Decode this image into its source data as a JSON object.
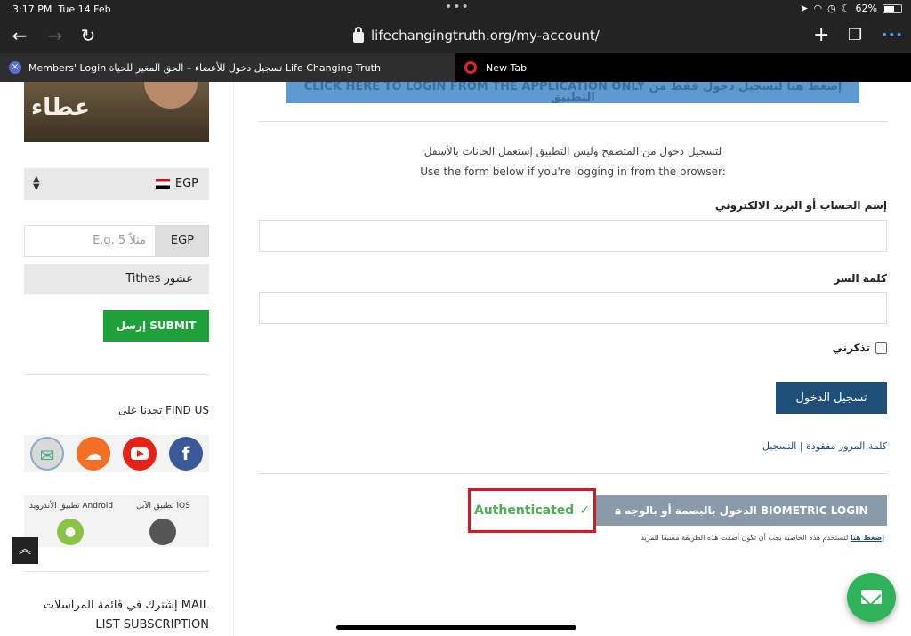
{
  "status_bar": {
    "time": "3:17 PM",
    "date": "Tue 14 Feb",
    "battery_percent": "62%",
    "battery_level": 0.62,
    "icons": [
      "location-icon",
      "wifi-icon",
      "alarm-icon",
      "lock-rotation-icon",
      "moon-icon",
      "battery-icon"
    ]
  },
  "browser": {
    "url": "lifechangingtruth.org/my-account/",
    "tabs": [
      {
        "title": "Members' Login تسجيل دخول للأعضاء – الحق المغير للحياة Life Changing Truth"
      },
      {
        "title": "New Tab"
      }
    ]
  },
  "sidebar": {
    "banner_text": "عطاء",
    "currency_select": "EGP",
    "amount_placeholder": "E.g. 5 مثلاً",
    "amount_currency": "EGP",
    "tithes": "Tithes عشور",
    "submit_label": "إرسل SUBMIT",
    "find_us": "تجدنا على FIND US",
    "social": [
      "facebook-icon",
      "youtube-icon",
      "soundcloud-icon",
      "app-icon"
    ],
    "ios_label": "تطبيق الآبل iOS",
    "android_label": "تطبيق الأندرويد Android",
    "mail_subscription_line1": "إشترك في قائمة المراسلات MAIL",
    "mail_subscription_line2": "LIST SUBSCRIPTION"
  },
  "main": {
    "app_login_button": "CLICK HERE TO LOGIN FROM THE APPLICATION ONLY إضغط هنا لتسجيل دخول فقط من التطبيق",
    "instructions_ar": "لتسجيل دخول من المتصفح وليس التطبيق إستعمل الخانات بالأسفل",
    "instructions_en": "Use the form below if you're logging in from the browser:",
    "username_label": "إسم الحساب أو البريد الالكتروني",
    "password_label": "كلمة السر",
    "remember_label": "تذكرني",
    "login_button": "تسجيل الدخول",
    "register_link": "التسجيل",
    "separator": "|",
    "lost_password_link": "كلمة المرور مفقودة",
    "authenticated_label": "Authenticated",
    "biometric_button": "الدخول بالبصمة أو بالوجه BIOMETRIC LOGIN",
    "biometric_note": "لتستخدم هذه الخاصية يجب أن تكون أضفت هذه الطريقة مسبقا للمزيد",
    "biometric_more": "إضغط هنا"
  },
  "colors": {
    "submit_green": "#1fa13a",
    "login_navy": "#1f4e79",
    "auth_red": "#d7191f",
    "auth_green": "#4caf50",
    "biometric_gray": "#8a9aab",
    "fab_green": "#2fb35a"
  }
}
